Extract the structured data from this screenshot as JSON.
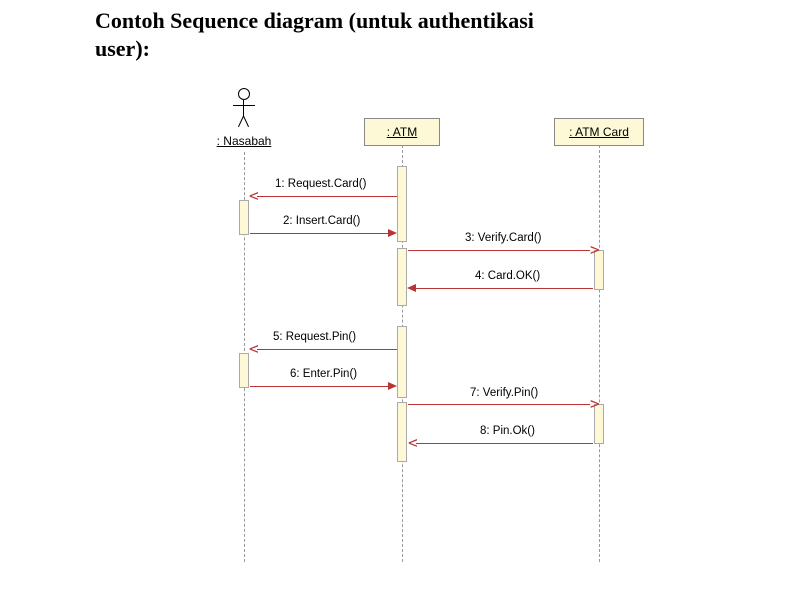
{
  "title": "Contoh Sequence diagram (untuk authentikasi user):",
  "lifelines": {
    "nasabah": {
      "label": ": Nasabah"
    },
    "atm": {
      "label": ": ATM"
    },
    "atmcard": {
      "label": ": ATM Card"
    }
  },
  "messages": {
    "m1": {
      "label": "1: Request.Card()"
    },
    "m2": {
      "label": "2: Insert.Card()"
    },
    "m3": {
      "label": "3: Verify.Card()"
    },
    "m4": {
      "label": "4: Card.OK()"
    },
    "m5": {
      "label": "5: Request.Pin()"
    },
    "m6": {
      "label": "6: Enter.Pin()"
    },
    "m7": {
      "label": "7: Verify.Pin()"
    },
    "m8": {
      "label": "8: Pin.Ok()"
    }
  },
  "chart_data": {
    "type": "sequence-diagram",
    "title": "Contoh Sequence diagram (untuk authentikasi user)",
    "participants": [
      {
        "id": "nasabah",
        "name": ": Nasabah",
        "kind": "actor"
      },
      {
        "id": "atm",
        "name": ": ATM",
        "kind": "object"
      },
      {
        "id": "atmcard",
        "name": ": ATM Card",
        "kind": "object"
      }
    ],
    "messages": [
      {
        "seq": 1,
        "from": "atm",
        "to": "nasabah",
        "label": "Request.Card()"
      },
      {
        "seq": 2,
        "from": "nasabah",
        "to": "atm",
        "label": "Insert.Card()"
      },
      {
        "seq": 3,
        "from": "atm",
        "to": "atmcard",
        "label": "Verify.Card()"
      },
      {
        "seq": 4,
        "from": "atmcard",
        "to": "atm",
        "label": "Card.OK()"
      },
      {
        "seq": 5,
        "from": "atm",
        "to": "nasabah",
        "label": "Request.Pin()"
      },
      {
        "seq": 6,
        "from": "nasabah",
        "to": "atm",
        "label": "Enter.Pin()"
      },
      {
        "seq": 7,
        "from": "atm",
        "to": "atmcard",
        "label": "Verify.Pin()"
      },
      {
        "seq": 8,
        "from": "atmcard",
        "to": "atm",
        "label": "Pin.Ok()"
      }
    ]
  }
}
